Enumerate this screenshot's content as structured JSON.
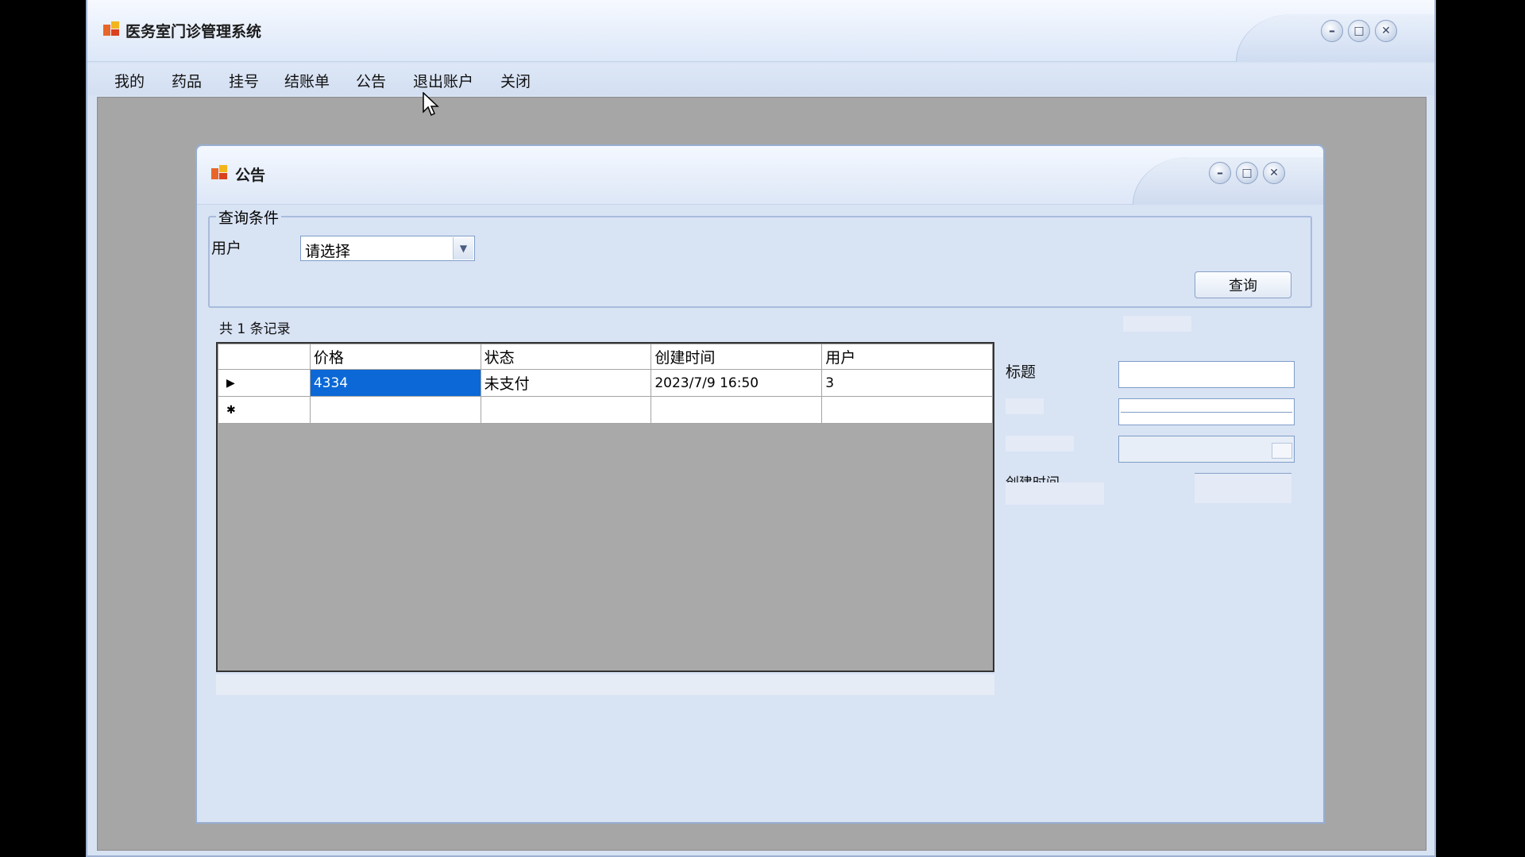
{
  "main_window": {
    "title": "医务室门诊管理系统",
    "buttons": {
      "minimize": "–",
      "maximize": "□",
      "close": "✕"
    }
  },
  "menu": [
    "我的",
    "药品",
    "挂号",
    "结账单",
    "公告",
    "退出账户",
    "关闭"
  ],
  "child_window": {
    "title": "公告",
    "buttons": {
      "minimize": "–",
      "maximize": "□",
      "close": "✕"
    }
  },
  "query": {
    "group_label": "查询条件",
    "user_label": "用户",
    "user_select": "请选择",
    "query_button": "查询"
  },
  "record_count": "共 1 条记录",
  "grid": {
    "columns": [
      "价格",
      "状态",
      "创建时间",
      "用户"
    ],
    "rows": [
      {
        "indicator": "▶",
        "price": "4334",
        "status": "未支付",
        "created": "2023/7/9 16:50",
        "user": "3"
      }
    ],
    "new_row_indicator": "✱"
  },
  "detail": {
    "title_label": "标题",
    "created_label": "创建时间"
  },
  "colors": {
    "accent": "#0b68d6",
    "window_bg": "#d8e3f4",
    "mdi_bg": "#a6a6a6"
  }
}
